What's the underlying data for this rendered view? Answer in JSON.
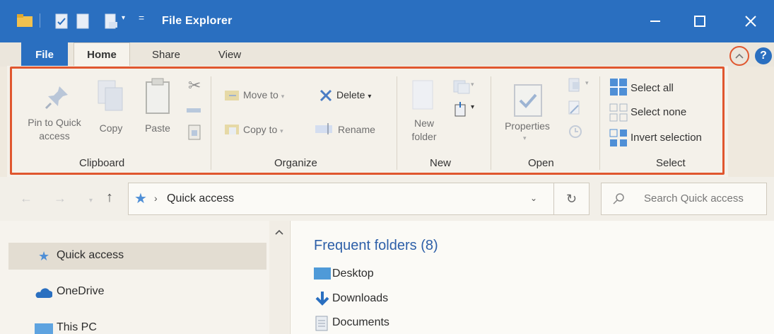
{
  "titlebar": {
    "title": "File Explorer",
    "bg_color": "#2a6fc0",
    "qa_icons": [
      "folder-icon",
      "properties-icon",
      "new-folder-icon",
      "customize-dropdown-icon"
    ],
    "controls": [
      "minimize-icon",
      "maximize-icon",
      "close-icon"
    ]
  },
  "tabs": {
    "file": "File",
    "home": "Home",
    "share": "Share",
    "view": "View",
    "collapse_icon": "chevron-up-icon",
    "help_icon": "help-icon"
  },
  "ribbon": {
    "highlight_color": "#e0572f",
    "clipboard": {
      "pin_line1": "Pin to Quick",
      "pin_line2": "access",
      "copy": "Copy",
      "paste": "Paste",
      "group": "Clipboard"
    },
    "organize": {
      "move_to": "Move to",
      "copy_to": "Copy to",
      "delete": "Delete",
      "rename": "Rename",
      "group": "Organize"
    },
    "new": {
      "folder_line1": "New",
      "folder_line2": "folder",
      "group": "New"
    },
    "open": {
      "properties": "Properties",
      "group": "Open"
    },
    "select": {
      "select_all": "Select all",
      "select_none": "Select none",
      "invert": "Invert selection",
      "group": "Select"
    }
  },
  "address": {
    "path": "Quick access",
    "search_placeholder": "Search Quick access"
  },
  "nav": {
    "items": [
      "Quick access",
      "OneDrive",
      "This PC"
    ]
  },
  "content": {
    "section_title": "Frequent folders (8)",
    "folders": [
      "Desktop",
      "Downloads",
      "Documents"
    ]
  }
}
